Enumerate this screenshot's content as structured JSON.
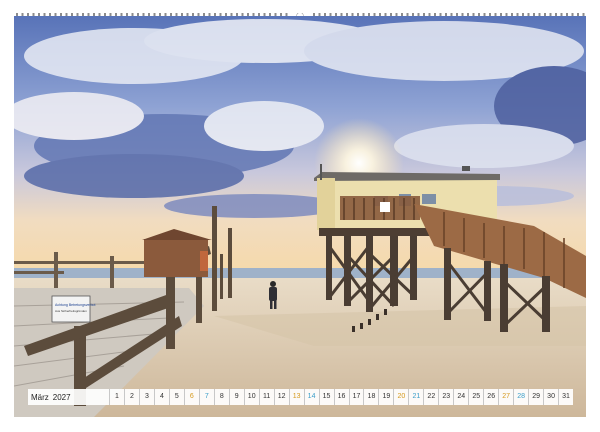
{
  "calendar": {
    "month": "März",
    "year": "2027",
    "days": [
      {
        "n": "1"
      },
      {
        "n": "2"
      },
      {
        "n": "3"
      },
      {
        "n": "4"
      },
      {
        "n": "5"
      },
      {
        "n": "6",
        "k": "sat"
      },
      {
        "n": "7",
        "k": "sun"
      },
      {
        "n": "8"
      },
      {
        "n": "9"
      },
      {
        "n": "10"
      },
      {
        "n": "11"
      },
      {
        "n": "12"
      },
      {
        "n": "13",
        "k": "sat"
      },
      {
        "n": "14",
        "k": "sun"
      },
      {
        "n": "15"
      },
      {
        "n": "16"
      },
      {
        "n": "17"
      },
      {
        "n": "18"
      },
      {
        "n": "19"
      },
      {
        "n": "20",
        "k": "sat"
      },
      {
        "n": "21",
        "k": "sun"
      },
      {
        "n": "22"
      },
      {
        "n": "23"
      },
      {
        "n": "24"
      },
      {
        "n": "25"
      },
      {
        "n": "26"
      },
      {
        "n": "27",
        "k": "sat"
      },
      {
        "n": "28",
        "k": "sun"
      },
      {
        "n": "29"
      },
      {
        "n": "30"
      },
      {
        "n": "31"
      }
    ],
    "colors": {
      "weekday": "#333333",
      "saturday": "#d59a1e",
      "sunday": "#3b9ec9"
    }
  },
  "photo": {
    "subject": "stilt house on the beach of Sankt Peter-Ording at sunset",
    "sign_line1": "Achtung Betretungsverbot",
    "sign_line2": "Aus Sicherheitsgründen"
  }
}
